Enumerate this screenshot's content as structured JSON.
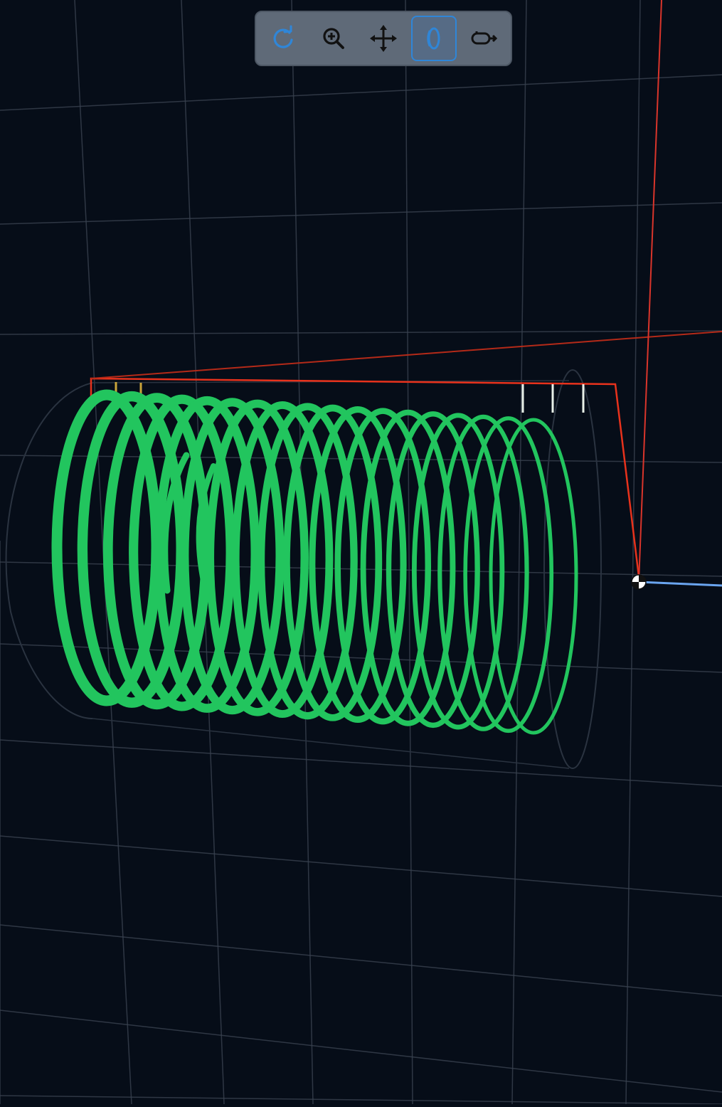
{
  "toolbar": {
    "tools": [
      {
        "icon": "orbit-rotate-icon",
        "active": true
      },
      {
        "icon": "zoom-in-icon",
        "active": false
      },
      {
        "icon": "pan-move-icon",
        "active": false
      },
      {
        "icon": "view-mode-icon",
        "active": true
      },
      {
        "icon": "fly-camera-icon",
        "active": false
      }
    ]
  },
  "scene": {
    "background_color": "#060d18",
    "grid_color": "#3a4250",
    "coil_color": "#22c55e",
    "lead_wire_color": "#e8321c",
    "x_axis_color": "#d9352b",
    "z_axis_color": "#6aa5f0",
    "coil_turns": 18
  }
}
